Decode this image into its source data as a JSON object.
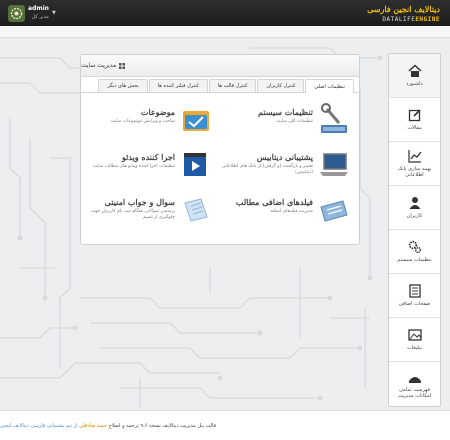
{
  "header": {
    "logo_fa": "دیتالایف انجین فارسی",
    "logo_en_prefix": "DATALIFE",
    "logo_en_suffix": "ENGINE",
    "user_name": "admin",
    "user_role": "مدیر کل"
  },
  "sidebar": {
    "items": [
      {
        "label": "داشبورد",
        "icon": "home-icon"
      },
      {
        "label": "مقالات",
        "icon": "edit-icon"
      },
      {
        "label": "بهینه سازی بانک اطلاعاتی",
        "icon": "chart-icon"
      },
      {
        "label": "کاربران",
        "icon": "user-icon"
      },
      {
        "label": "تنظیمات سیستم",
        "icon": "gears-icon"
      },
      {
        "label": "صفحات اضافی",
        "icon": "pages-icon"
      },
      {
        "label": "تبلیغات",
        "icon": "image-icon"
      },
      {
        "label": "فهرست تمامی امکانات مدیریت",
        "icon": "folder-icon"
      }
    ]
  },
  "panel": {
    "title": "مدیریت سایت",
    "tabs": [
      "تنظیمات اصلی",
      "کنترل کاربران",
      "کنترل قالب ها",
      "کنترل فیلتر کننده ها",
      "بخش های دیگر"
    ],
    "tiles": [
      {
        "title": "تنظیمات سیستم",
        "desc": "تنظیمات کلی سایت",
        "icon": "wrench-icon"
      },
      {
        "title": "موضوعات",
        "desc": "ساخت و ویرایش موضوعات سایت",
        "icon": "folder-box-icon"
      },
      {
        "title": "پشتیبانی دیتابیس",
        "desc": "تعمیر و بازگشت (و گرفتن) از بانک های اطلاعاتی (دیتابیس)",
        "icon": "laptop-icon"
      },
      {
        "title": "اجرا کننده ویدئو",
        "desc": "تنظیمات اجرا کننده ویدئو های مطالب سایت",
        "icon": "video-icon"
      },
      {
        "title": "فیلدهای اضافی مطالب",
        "desc": "مدیریت فیلدهای اضافه",
        "icon": "notebook-icon"
      },
      {
        "title": "سوال و جواب امنیتی",
        "desc": "پرسیدن سوالاتی هنگام ثبت نام کاربران جهت جلوگیری از اسپم",
        "icon": "paper-icon"
      }
    ]
  },
  "footer": {
    "text_a": "قالب پنل مدیریت دیتالایف نسخه ۹.۶ ترجمه و اصلاح",
    "author": "حمید صادقلی",
    "text_b": "از تیم پشتیبانی فارسی دیتالایف انجین"
  },
  "colors": {
    "accent": "#f0c000",
    "topbar": "#242424",
    "link": "#4a8fc2"
  }
}
